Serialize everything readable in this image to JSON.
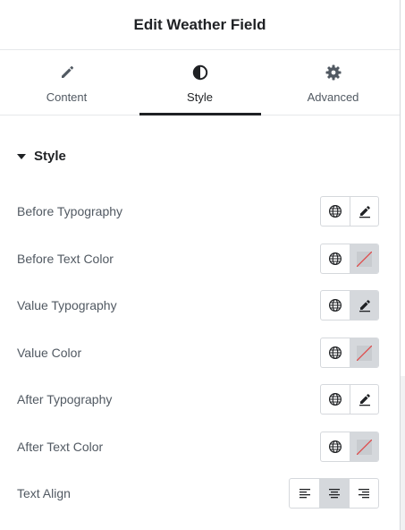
{
  "header": {
    "title": "Edit Weather Field"
  },
  "tabs": [
    {
      "label": "Content",
      "icon": "pencil-icon"
    },
    {
      "label": "Style",
      "icon": "half-circle-icon",
      "active": true
    },
    {
      "label": "Advanced",
      "icon": "gear-icon"
    }
  ],
  "section": {
    "title": "Style",
    "expanded": true
  },
  "controls": [
    {
      "label": "Before Typography",
      "type": "typography",
      "edit_active": false
    },
    {
      "label": "Before Text Color",
      "type": "color",
      "color_empty": true
    },
    {
      "label": "Value Typography",
      "type": "typography",
      "edit_active": true
    },
    {
      "label": "Value Color",
      "type": "color",
      "color_empty": true
    },
    {
      "label": "After Typography",
      "type": "typography",
      "edit_active": false
    },
    {
      "label": "After Text Color",
      "type": "color",
      "color_empty": true
    },
    {
      "label": "Text Align",
      "type": "align",
      "options": [
        "left",
        "center",
        "right"
      ],
      "selected": "center"
    }
  ],
  "colors": {
    "text_dark": "#1f2124",
    "text_label": "#515962",
    "border": "#d5d8dc",
    "active_bg": "#d5d8dc",
    "clear_line": "#e04545"
  }
}
